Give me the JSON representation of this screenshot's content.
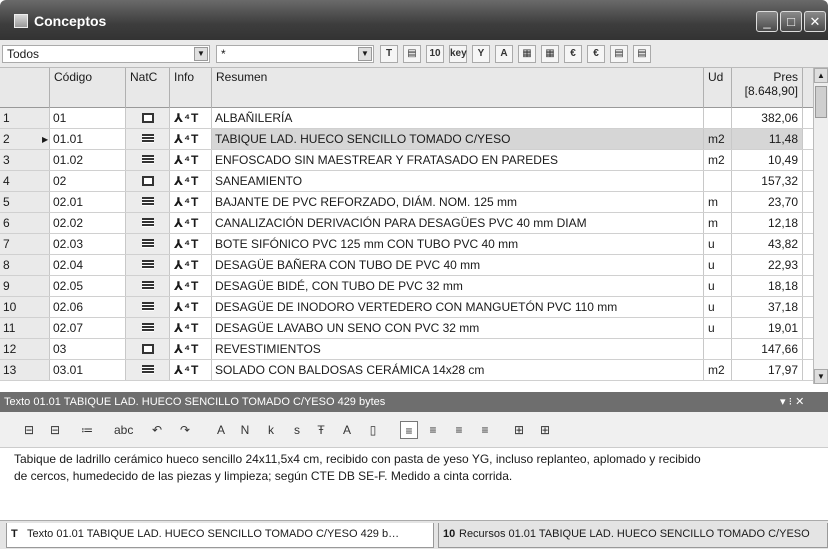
{
  "window": {
    "title": "Conceptos"
  },
  "filter": {
    "left_value": "Todos",
    "right_value": "*"
  },
  "toolbar_icons": [
    "T",
    "▤",
    "10",
    "key",
    "Y",
    "A",
    "▦",
    "▦",
    "€",
    "€",
    "▤",
    "▤"
  ],
  "table": {
    "headers": {
      "codigo": "Código",
      "natc": "NatC",
      "info": "Info",
      "resumen": "Resumen",
      "ud": "Ud",
      "pres": "Pres",
      "pres_total": "[8.648,90]"
    },
    "rows": [
      {
        "n": "1",
        "codigo": "01",
        "natc": "chapter",
        "resumen": "ALBAÑILERÍA",
        "ud": "",
        "pres": "382,06"
      },
      {
        "n": "2",
        "codigo": "01.01",
        "natc": "partida",
        "resumen": "TABIQUE LAD. HUECO SENCILLO TOMADO C/YESO",
        "ud": "m2",
        "pres": "11,48",
        "selected": true
      },
      {
        "n": "3",
        "codigo": "01.02",
        "natc": "partida",
        "resumen": "ENFOSCADO SIN MAESTREAR Y FRATASADO EN PAREDES",
        "ud": "m2",
        "pres": "10,49"
      },
      {
        "n": "4",
        "codigo": "02",
        "natc": "chapter",
        "resumen": "SANEAMIENTO",
        "ud": "",
        "pres": "157,32"
      },
      {
        "n": "5",
        "codigo": "02.01",
        "natc": "partida",
        "resumen": "BAJANTE DE PVC REFORZADO, DIÁM. NOM. 125 mm",
        "ud": "m",
        "pres": "23,70"
      },
      {
        "n": "6",
        "codigo": "02.02",
        "natc": "partida",
        "resumen": "CANALIZACIÓN DERIVACIÓN PARA DESAGÜES PVC 40 mm DIAM",
        "ud": "m",
        "pres": "12,18"
      },
      {
        "n": "7",
        "codigo": "02.03",
        "natc": "partida",
        "resumen": "BOTE SIFÓNICO PVC 125 mm CON TUBO PVC 40 mm",
        "ud": "u",
        "pres": "43,82"
      },
      {
        "n": "8",
        "codigo": "02.04",
        "natc": "partida",
        "resumen": "DESAGÜE BAÑERA CON TUBO DE PVC 40 mm",
        "ud": "u",
        "pres": "22,93"
      },
      {
        "n": "9",
        "codigo": "02.05",
        "natc": "partida",
        "resumen": "DESAGÜE BIDÉ, CON TUBO DE PVC 32 mm",
        "ud": "u",
        "pres": "18,18"
      },
      {
        "n": "10",
        "codigo": "02.06",
        "natc": "partida",
        "resumen": "DESAGÜE DE INODORO VERTEDERO CON MANGUETÓN PVC 110 mm",
        "ud": "u",
        "pres": "37,18"
      },
      {
        "n": "11",
        "codigo": "02.07",
        "natc": "partida",
        "resumen": "DESAGÜE LAVABO UN SENO CON PVC 32 mm",
        "ud": "u",
        "pres": "19,01"
      },
      {
        "n": "12",
        "codigo": "03",
        "natc": "chapter",
        "resumen": "REVESTIMIENTOS",
        "ud": "",
        "pres": "147,66"
      },
      {
        "n": "13",
        "codigo": "03.01",
        "natc": "partida",
        "resumen": "SOLADO CON BALDOSAS CERÁMICA 14x28 cm",
        "ud": "m2",
        "pres": "17,97"
      }
    ]
  },
  "text_panel": {
    "title": "Texto 01.01 TABIQUE LAD. HUECO SENCILLO TOMADO C/YESO 429 bytes",
    "pin": "▾ ⁝ ✕",
    "body_line1": "Tabique de ladrillo cerámico hueco sencillo 24x11,5x4 cm, recibido con pasta de yeso YG, incluso replanteo, aplomado y recibido",
    "body_line2": "de cercos, humedecido de las piezas y limpieza; según CTE DB SE-F. Medido a cinta corrida."
  },
  "edit_toolbar": [
    "⊟",
    "⊟",
    "≔",
    "abc",
    "↶",
    "↷",
    "A",
    "N",
    "k",
    "s",
    "Ŧ",
    "A",
    "▯",
    "≡",
    "≡",
    "≡",
    "≡",
    "⊞",
    "⊞"
  ],
  "tabs": [
    {
      "label": "Texto 01.01 TABIQUE LAD. HUECO SENCILLO TOMADO C/YESO 429 b…",
      "icon": "T"
    },
    {
      "label": "Recursos 01.01 TABIQUE LAD. HUECO SENCILLO TOMADO C/YESO",
      "icon": "10"
    }
  ]
}
